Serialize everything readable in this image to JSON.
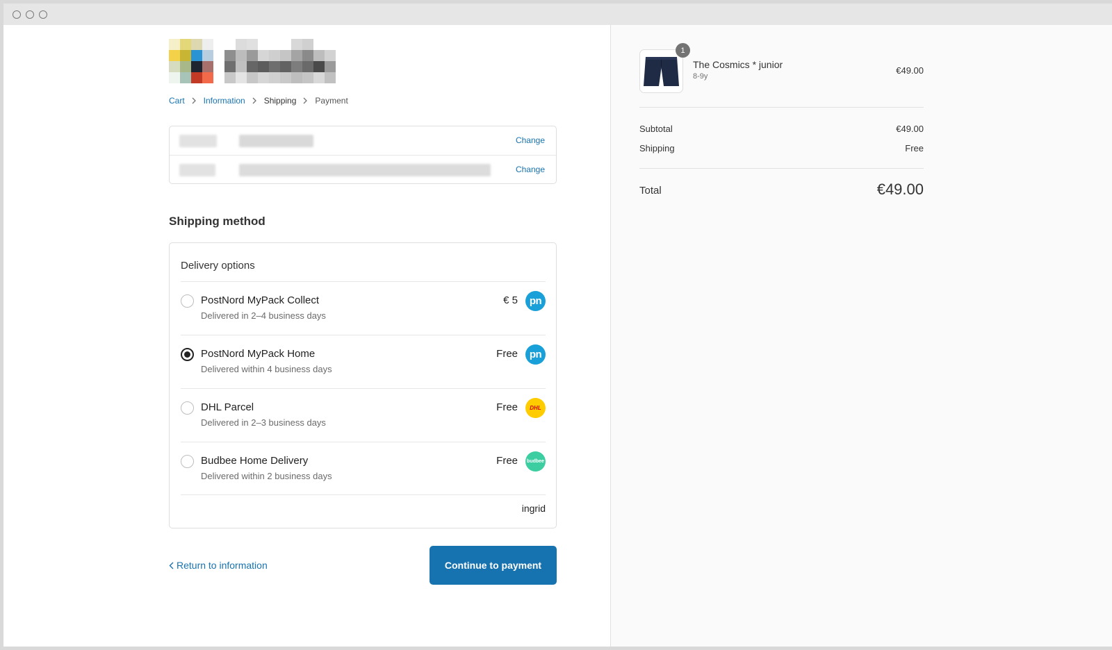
{
  "window": {
    "controls": [
      "close",
      "minimize",
      "maximize"
    ]
  },
  "breadcrumb": {
    "cart": "Cart",
    "information": "Information",
    "shipping": "Shipping",
    "payment": "Payment"
  },
  "review": {
    "change_label_1": "Change",
    "change_label_2": "Change"
  },
  "shipping_method": {
    "title": "Shipping method",
    "options_heading": "Delivery options",
    "options": [
      {
        "name": "PostNord MyPack Collect",
        "desc": "Delivered in 2–4 business days",
        "price": "€ 5",
        "carrier_logo": "pn",
        "selected": false
      },
      {
        "name": "PostNord MyPack Home",
        "desc": "Delivered within 4 business days",
        "price": "Free",
        "carrier_logo": "pn",
        "selected": true
      },
      {
        "name": "DHL Parcel",
        "desc": "Delivered in 2–3 business days",
        "price": "Free",
        "carrier_logo": "DHL",
        "selected": false
      },
      {
        "name": "Budbee Home Delivery",
        "desc": "Delivered within 2 business days",
        "price": "Free",
        "carrier_logo": "budbee",
        "selected": false
      }
    ],
    "powered_by": "ingrid"
  },
  "actions": {
    "return_label": "Return to information",
    "continue_label": "Continue to payment"
  },
  "order_summary": {
    "product": {
      "name": "The Cosmics * junior",
      "variant": "8-9y",
      "price": "€49.00",
      "quantity": "1",
      "thumbnail_icon": "shorts-icon"
    },
    "subtotal_label": "Subtotal",
    "subtotal_value": "€49.00",
    "shipping_label": "Shipping",
    "shipping_value": "Free",
    "total_label": "Total",
    "total_value": "€49.00"
  },
  "colors": {
    "accent": "#1773b0",
    "postnord": "#1aa0d8",
    "dhl_yellow": "#ffcc00",
    "dhl_red": "#d40511",
    "budbee": "#3ccea1"
  }
}
